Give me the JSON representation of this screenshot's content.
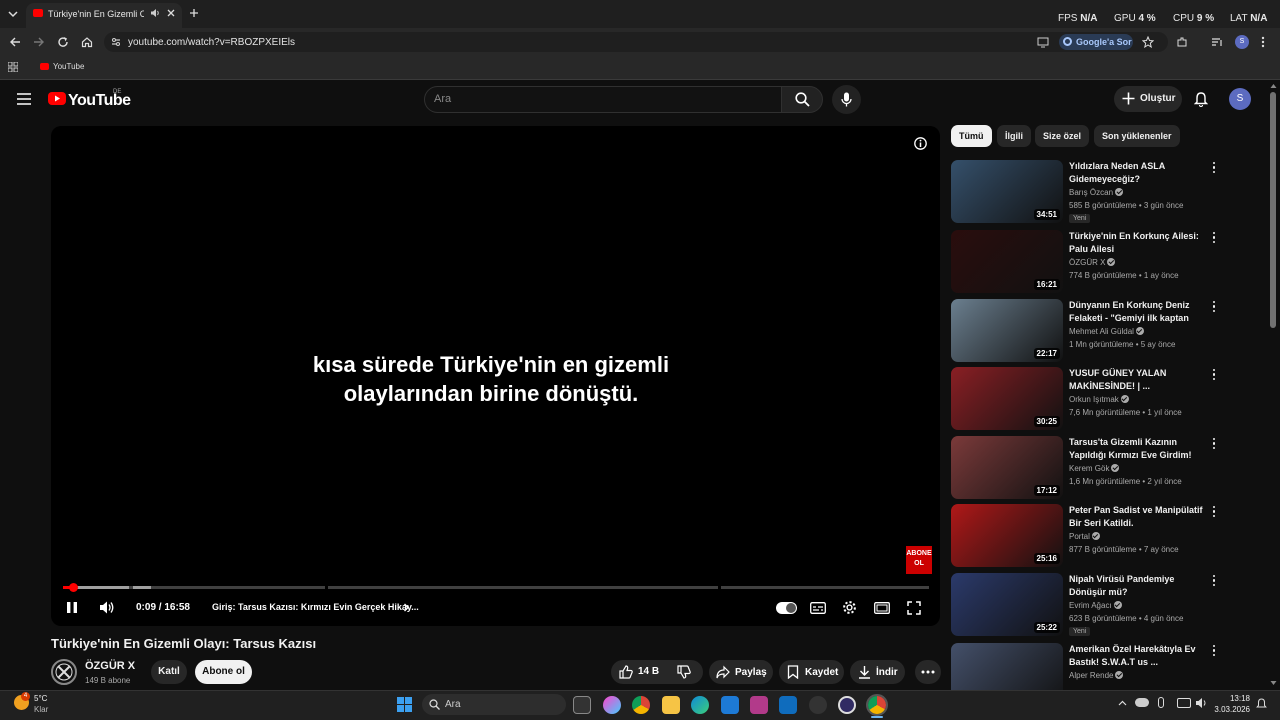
{
  "browser": {
    "tab_title": "Türkiye'nin En Gizemli Olay",
    "url": "youtube.com/watch?v=RBOZPXEIEls",
    "ask_google_label": "Google'a Sor",
    "bookmark_label": "YouTube",
    "avatar_letter": "S"
  },
  "perf_overlay": {
    "fps_label": "FPS",
    "fps_value": "N/A",
    "gpu_label": "GPU",
    "gpu_value": "4 %",
    "cpu_label": "CPU",
    "cpu_value": "9 %",
    "lat_label": "LAT",
    "lat_value": "N/A"
  },
  "youtube": {
    "logo_text": "YouTube",
    "region": "DE",
    "search_placeholder": "Ara",
    "create_label": "Oluştur",
    "avatar_letter": "S"
  },
  "player": {
    "subtitle_line1": "kısa sürede Türkiye'nin en gizemli",
    "subtitle_line2": "olaylarından birine dönüştü.",
    "current_time": "0:09",
    "duration": "16:58",
    "time_sep": "/",
    "chapter": "Giriş: Tarsus Kazısı: Kırmızı Evin Gerçek Hikay...",
    "progress_fraction": 0.009,
    "subscribe_overlay": "ABONE OL"
  },
  "video": {
    "title": "Türkiye'nin En Gizemli Olayı: Tarsus Kazısı",
    "channel": "ÖZGÜR X",
    "subscribers": "149 B abone",
    "join_label": "Katıl",
    "subscribe_label": "Abone ol",
    "likes": "14 B",
    "share_label": "Paylaş",
    "save_label": "Kaydet",
    "download_label": "İndir"
  },
  "filters": [
    "Tümü",
    "İlgili",
    "Size özel",
    "Son yüklenenler"
  ],
  "recommendations": [
    {
      "title": "Yıldızlara Neden ASLA Gidemeyeceğiz?",
      "channel": "Barış Özcan",
      "meta": "585 B görüntüleme • 3 gün önce",
      "badge": "Yeni",
      "duration": "34:51",
      "color": "#35506b"
    },
    {
      "title": "Türkiye'nin En Korkunç Ailesi: Palu Ailesi",
      "channel": "ÖZGÜR X",
      "meta": "774 B görüntüleme • 1 ay önce",
      "badge": "",
      "duration": "16:21",
      "color": "#2a0d0d"
    },
    {
      "title": "Dünyanın En Korkunç Deniz Felaketi - \"Gemiyi ilk kaptan te...",
      "channel": "Mehmet Ali Güldal",
      "meta": "1 Mn görüntüleme • 5 ay önce",
      "badge": "",
      "duration": "22:17",
      "color": "#6b7f8f"
    },
    {
      "title": "YUSUF GÜNEY YALAN MAKİNESİNDE! | ...",
      "channel": "Orkun Işıtmak",
      "meta": "7,6 Mn görüntüleme • 1 yıl önce",
      "badge": "",
      "duration": "30:25",
      "color": "#8a1f24"
    },
    {
      "title": "Tarsus'ta Gizemli Kazının Yapıldığı Kırmızı Eve Girdim!",
      "channel": "Kerem Gök",
      "meta": "1,6 Mn görüntüleme • 2 yıl önce",
      "badge": "",
      "duration": "17:12",
      "color": "#7b3a3a"
    },
    {
      "title": "Peter Pan Sadist ve Manipülatif Bir Seri Katildi.",
      "channel": "Portal",
      "meta": "877 B görüntüleme • 7 ay önce",
      "badge": "",
      "duration": "25:16",
      "color": "#b01818"
    },
    {
      "title": "Nipah Virüsü Pandemiye Dönüşür mü?",
      "channel": "Evrim Ağacı",
      "meta": "623 B görüntüleme • 4 gün önce",
      "badge": "Yeni",
      "duration": "25:22",
      "color": "#2b3a6b"
    },
    {
      "title": "Amerikan Özel Harekâtıyla Ev Bastık! S.W.A.T us ...",
      "channel": "Alper Rende",
      "meta": "",
      "badge": "",
      "duration": "",
      "color": "#44506a"
    }
  ],
  "taskbar": {
    "weather_temp": "5°C",
    "weather_desc": "Klar",
    "search_label": "Ara",
    "time": "13:18",
    "date": "3.03.2026",
    "weather_badge": "4"
  }
}
